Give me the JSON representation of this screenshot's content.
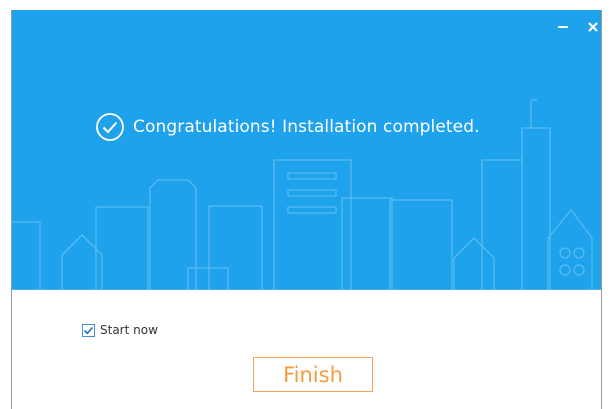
{
  "window": {
    "minimize_icon": "minimize-icon",
    "close_icon": "close-icon"
  },
  "hero": {
    "success_icon": "check-circle-icon",
    "message": "Congratulations! Installation completed.",
    "background_color": "#1ea2ec"
  },
  "options": {
    "start_now_label": "Start now",
    "start_now_checked": true
  },
  "actions": {
    "finish_label": "Finish",
    "accent_color": "#f39c3c"
  }
}
